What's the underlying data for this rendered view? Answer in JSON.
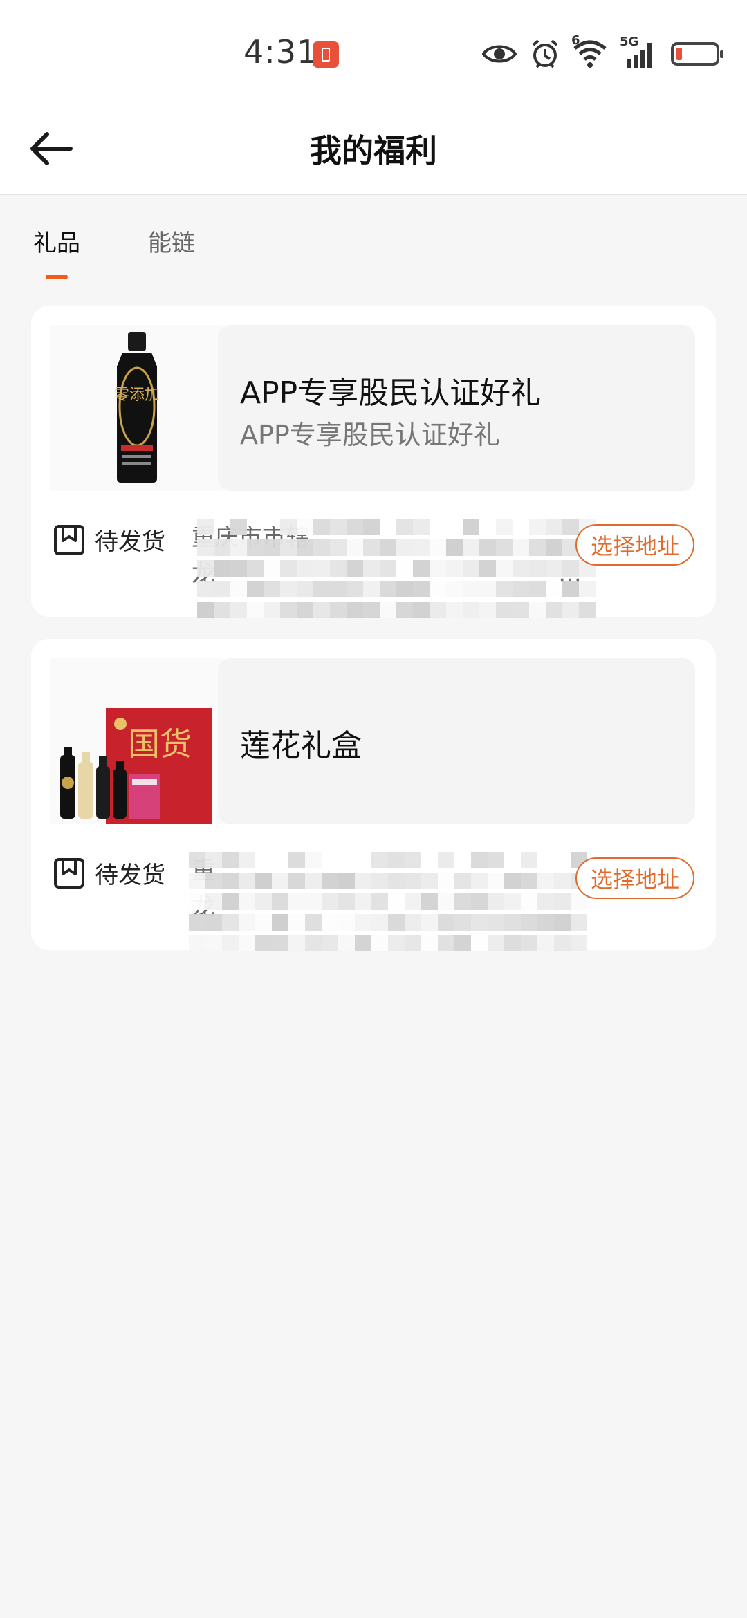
{
  "status_bar": {
    "time": "4:31",
    "icons": [
      "battery-alert-icon",
      "eye-icon",
      "alarm-icon",
      "wifi-icon",
      "signal-5g-icon",
      "battery-icon"
    ],
    "wifi_badge": "6",
    "network_label": "5G"
  },
  "header": {
    "title": "我的福利",
    "back_icon": "back-arrow-icon"
  },
  "tabs": [
    {
      "label": "礼品",
      "active": true
    },
    {
      "label": "能链",
      "active": false
    }
  ],
  "gifts": [
    {
      "title": "APP专享股民认证好礼",
      "subtitle": "APP专享股民认证好礼",
      "image_icon": "soy-sauce-bottle-image",
      "image_text": "零添加",
      "status_icon": "package-icon",
      "status": "待发货",
      "address_line1": "重庆市市辖",
      "address_line2": "龙",
      "address_ellipsis": "…",
      "button": "选择地址"
    },
    {
      "title": "莲花礼盒",
      "subtitle": "",
      "image_icon": "gift-box-image",
      "image_text": "国货",
      "status_icon": "package-icon",
      "status": "待发货",
      "address_line1": "重",
      "address_line2": "龙",
      "address_ellipsis": "",
      "button": "选择地址"
    }
  ],
  "colors": {
    "accent": "#f25c1b",
    "button_border": "#e06b2c",
    "background": "#f6f6f6"
  }
}
